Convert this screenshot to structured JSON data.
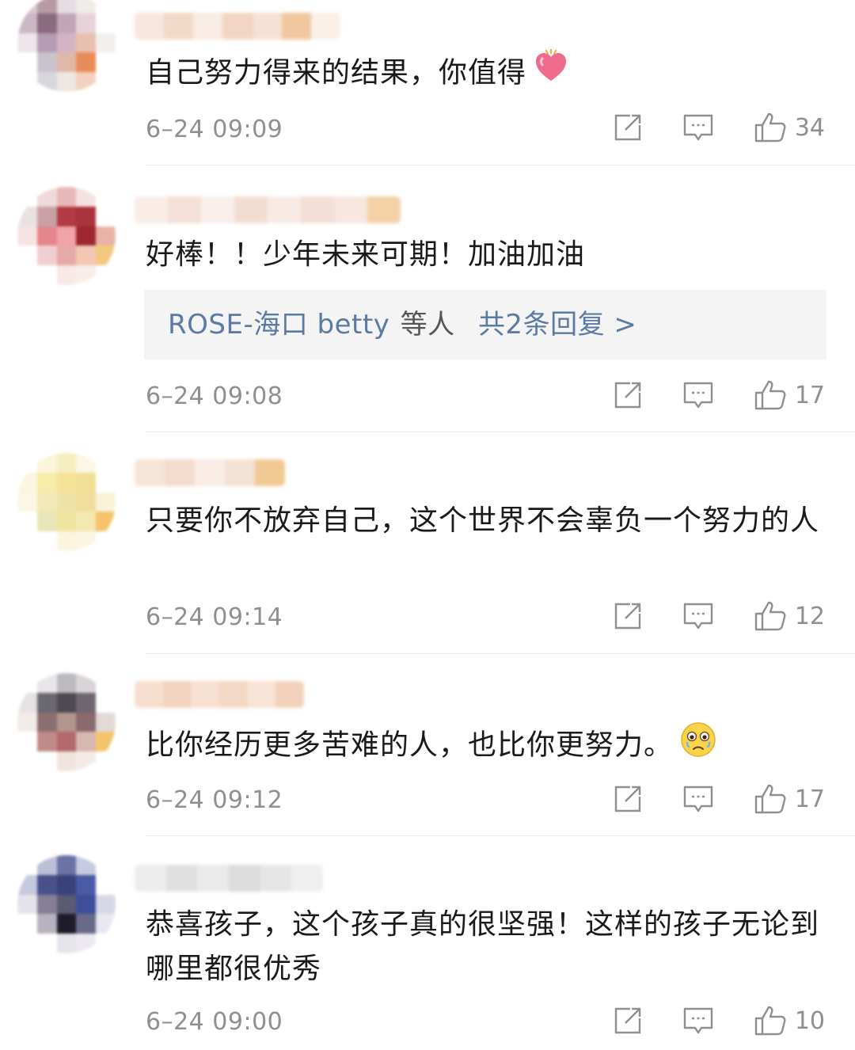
{
  "comments": [
    {
      "text": "自己努力得来的结果，你值得",
      "emoji": "heart-emoji",
      "time": "6–24 09:09",
      "likes": "34"
    },
    {
      "text": "好棒！！少年未来可期！加油加油",
      "reply_summary": {
        "users": "ROSE-海口 betty",
        "mid": "等人",
        "count_label": "共2条回复 >"
      },
      "time": "6–24 09:08",
      "likes": "17"
    },
    {
      "text": "只要你不放弃自己，这个世界不会辜负一个努力的人",
      "time": "6–24 09:14",
      "likes": "12"
    },
    {
      "text": "比你经历更多苦难的人，也比你更努力。",
      "emoji": "teary-face-emoji",
      "time": "6–24 09:12",
      "likes": "17"
    },
    {
      "text": "恭喜孩子，这个孩子真的很坚强！这样的孩子无论到哪里都很优秀",
      "time": "6–24 09:00",
      "likes": "10"
    }
  ],
  "icons": {
    "share": "share-icon",
    "reply": "comment-icon",
    "like": "thumbs-up-icon"
  },
  "colors": {
    "text": "#1a1a1a",
    "meta": "#8f8f8f",
    "link": "#5b7aa3",
    "reply_bg": "#f4f4f4"
  }
}
